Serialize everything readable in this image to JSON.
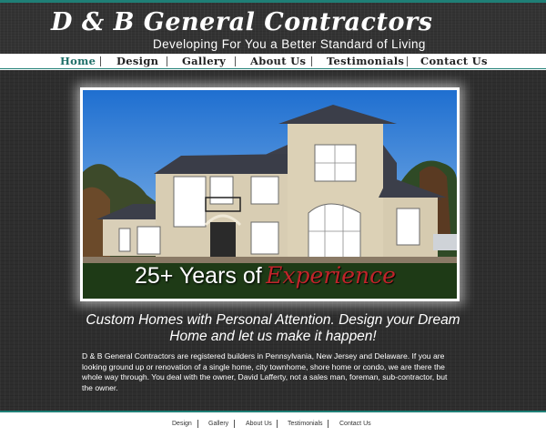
{
  "header": {
    "title": "D & B General Contractors",
    "tagline": "Developing For You a Better Standard of Living"
  },
  "nav": {
    "items": [
      {
        "label": "Home",
        "active": true
      },
      {
        "label": "Design"
      },
      {
        "label": "Gallery"
      },
      {
        "label": "About Us"
      },
      {
        "label": "Testimonials"
      },
      {
        "label": "Contact Us"
      }
    ]
  },
  "hero": {
    "caption_prefix": "25+ Years of",
    "caption_highlight": "Experience"
  },
  "main": {
    "headline": "Custom Homes with Personal Attention. Design your Dream Home and let us make it happen!",
    "intro": "D & B General Contractors are registered builders in Pennsylvania, New Jersey and Delaware. If you are looking ground up or renovation of a single home, city townhome, shore home or condo, we are there the whole way through. You deal with the owner, David Lafferty, not a sales man, foreman, sub-contractor, but the owner."
  },
  "footer": {
    "links": [
      "Design",
      "Gallery",
      "About Us",
      "Testimonials",
      "Contact Us"
    ]
  },
  "colors": {
    "accent": "#1f7f76",
    "highlight": "#c0242a",
    "background": "#2e2e2e"
  }
}
